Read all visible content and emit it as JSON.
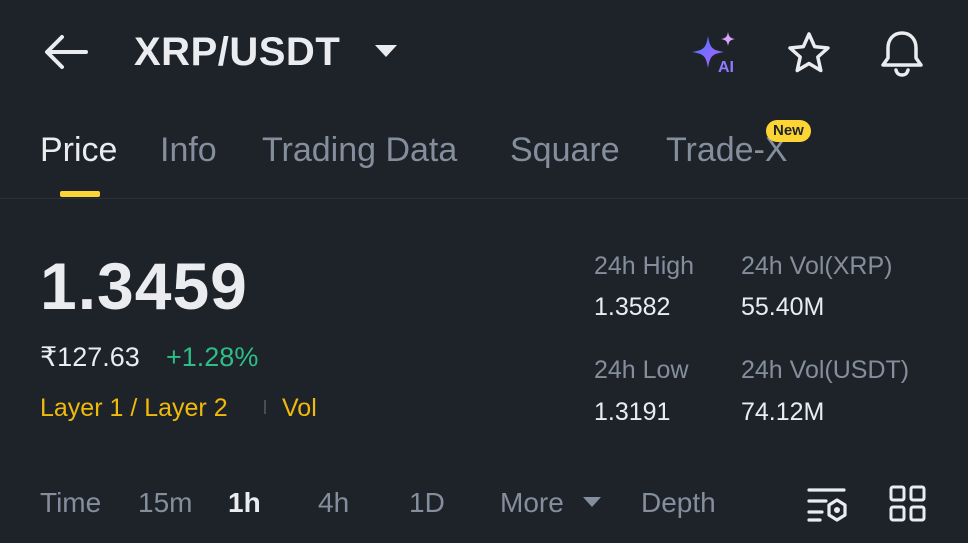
{
  "header": {
    "pair": "XRP/USDT",
    "ai_badge": "AI",
    "icons": [
      "back-arrow-icon",
      "caret-down-icon",
      "ai-sparkle-icon",
      "star-icon",
      "bell-icon"
    ]
  },
  "tabs": [
    {
      "label": "Price",
      "active": true
    },
    {
      "label": "Info"
    },
    {
      "label": "Trading Data"
    },
    {
      "label": "Square"
    },
    {
      "label": "Trade-X",
      "badge": "New"
    }
  ],
  "ticker": {
    "last_price": "1.3459",
    "fiat_price": "₹127.63",
    "change_pct": "+1.28%",
    "tag_category": "Layer 1 / Layer 2",
    "tag_vol": "Vol"
  },
  "stats": {
    "high_label": "24h High",
    "high_value": "1.3582",
    "vol_xrp_label": "24h Vol(XRP)",
    "vol_xrp_value": "55.40M",
    "low_label": "24h Low",
    "low_value": "1.3191",
    "vol_usdt_label": "24h Vol(USDT)",
    "vol_usdt_value": "74.12M"
  },
  "intervals": {
    "time": "Time",
    "m15": "15m",
    "h1": "1h",
    "h4": "4h",
    "d1": "1D",
    "more": "More",
    "depth": "Depth",
    "selected": "1h"
  },
  "colors": {
    "background": "#1e2329",
    "accent_yellow": "#fcd535",
    "positive_green": "#2ebd85",
    "muted_text": "#848e9c",
    "primary_text": "#eaecef"
  }
}
